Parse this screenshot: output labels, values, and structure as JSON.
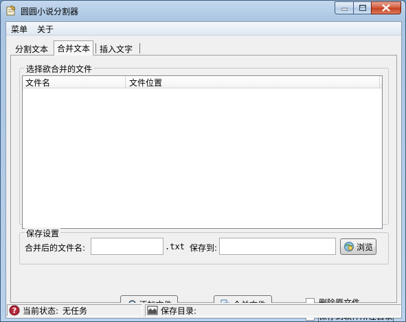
{
  "window": {
    "title": "圆圆小说分割器",
    "accent_color": "#3a6ea5",
    "close_color": "#c7432a"
  },
  "menu": {
    "items": [
      "菜单",
      "关于"
    ]
  },
  "tabs": [
    "分割文本",
    "合并文本",
    "插入文字"
  ],
  "active_tab": "合并文本",
  "merge": {
    "group_title": "选择欲合并的文件",
    "columns": [
      "文件名",
      "文件位置"
    ],
    "rows": []
  },
  "save": {
    "group_title": "保存设置",
    "filename_label": "合并后的文件名:",
    "filename_value": "",
    "extension": ".txt",
    "save_to_label": "保存到:",
    "save_to_value": "",
    "browse_label": "浏览"
  },
  "actions": {
    "add_label": "添加文件",
    "merge_label": "合并文件"
  },
  "options": {
    "delete_original_label": "删除原文件",
    "delete_original_checked": false,
    "save_to_software_dir_label": "保存到软件所在目录",
    "save_to_software_dir_checked": false
  },
  "status": {
    "state_label": "当前状态:",
    "state_value": "无任务",
    "save_dir_label": "保存目录:",
    "save_dir_value": ""
  }
}
